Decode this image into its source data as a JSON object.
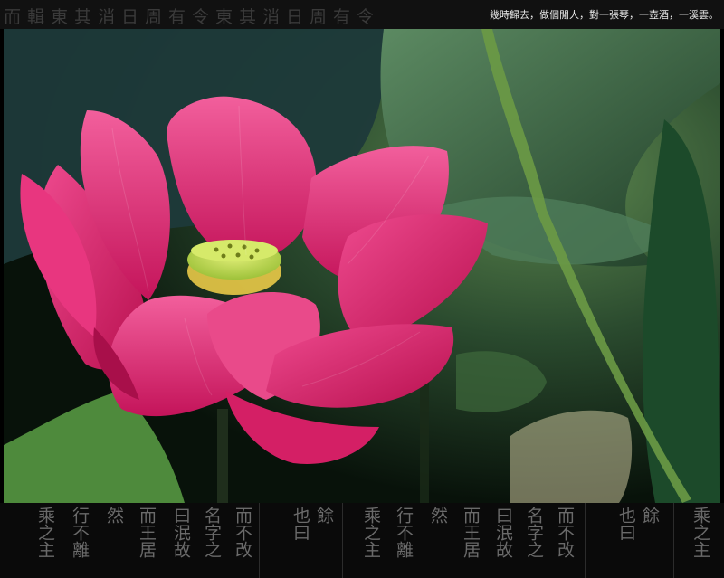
{
  "header": {
    "calligraphy_strip": "而輯東其消日周有令東其消日周有令",
    "caption": "幾時歸去，做個閒人，對一張琴，一壺酒，一溪雲。"
  },
  "footer": {
    "calligraphy_columns": [
      "乘之主",
      "行不離",
      "然",
      "而王居",
      "曰泯故",
      "名字之",
      "而不改",
      "也曰",
      "餘",
      "乘之主",
      "行不離",
      "然",
      "而王居",
      "曰泯故",
      "名字之",
      "而不改",
      "也曰",
      "餘",
      "乘之主"
    ]
  },
  "photo": {
    "subject": "pink lotus flower with green seed pod among lotus leaves",
    "colors": {
      "petal": "#e0226e",
      "petal_light": "#f0579a",
      "pod": "#c8e04a",
      "leaf": "#2f5a3a",
      "leaf_light": "#6e9a55",
      "background": "#0d1a10"
    }
  }
}
